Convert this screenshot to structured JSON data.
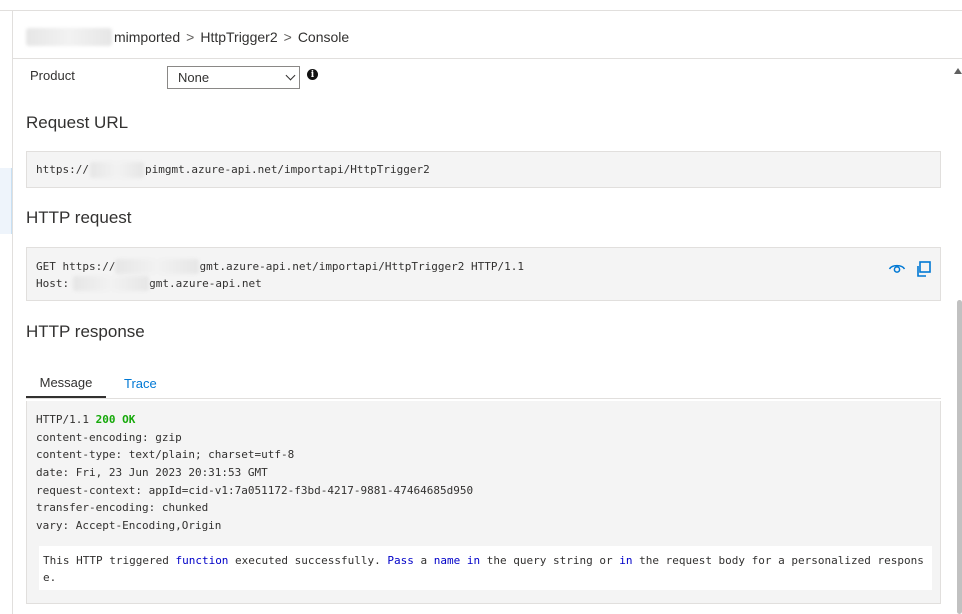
{
  "breadcrumb": {
    "items": [
      "mimported",
      "HttpTrigger2",
      "Console"
    ],
    "separator": ">"
  },
  "product": {
    "label": "Product",
    "selected": "None"
  },
  "request_url": {
    "title": "Request URL",
    "prefix": "https://",
    "suffix": "pimgmt.azure-api.net/importapi/HttpTrigger2"
  },
  "http_request": {
    "title": "HTTP request",
    "line1_prefix": "GET https://",
    "line1_suffix": "gmt.azure-api.net/importapi/HttpTrigger2 HTTP/1.1",
    "line2_prefix": "Host:",
    "line2_suffix": "gmt.azure-api.net"
  },
  "http_response": {
    "title": "HTTP response",
    "tabs": [
      {
        "label": "Message",
        "active": true
      },
      {
        "label": "Trace",
        "active": false
      }
    ],
    "status_proto": "HTTP/1.1 ",
    "status_code": "200 OK",
    "headers": [
      "content-encoding: gzip",
      "content-type: text/plain; charset=utf-8",
      "date: Fri, 23 Jun 2023 20:31:53 GMT",
      "request-context: appId=cid-v1:7a051172-f3bd-4217-9881-47464685d950",
      "transfer-encoding: chunked",
      "vary: Accept-Encoding,Origin"
    ],
    "body": {
      "t1": "This HTTP triggered ",
      "k1": "function",
      "t2": " executed successfully. ",
      "k2": "Pass",
      "t3": " a ",
      "k3": "name",
      "t4": " ",
      "k4": "in",
      "t5": " the query string or ",
      "k5": "in",
      "t6": " the request body for a personalized response."
    }
  },
  "colors": {
    "accent": "#0078d4",
    "status_ok": "#16a90a",
    "code_background": "#f4f4f4",
    "keyword": "#0000c8"
  },
  "icons": {
    "info": "info-icon",
    "view": "eye-icon",
    "copy": "copy-icon"
  }
}
